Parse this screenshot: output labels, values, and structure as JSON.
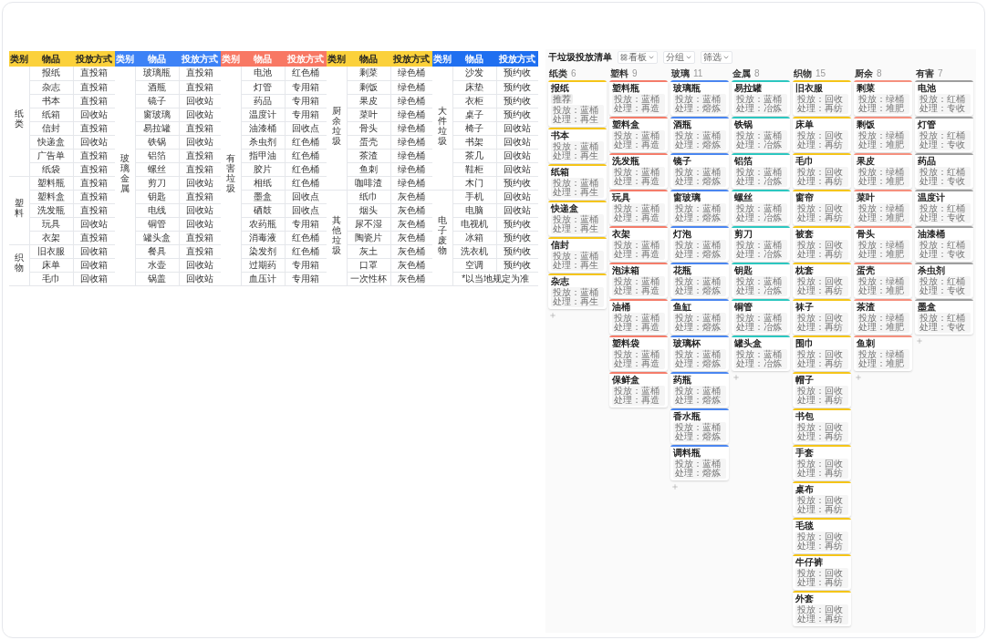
{
  "table": {
    "groups": [
      {
        "category_header": "类别",
        "item_header": "物品",
        "method_header": "投放方式",
        "color": "#fbd13b",
        "sections": [
          {
            "label": "纸类",
            "rows": [
              {
                "item": "报纸",
                "method": "直投箱"
              },
              {
                "item": "杂志",
                "method": "直投箱"
              },
              {
                "item": "书本",
                "method": "直投箱"
              },
              {
                "item": "纸箱",
                "method": "回收站"
              },
              {
                "item": "信封",
                "method": "直投箱"
              },
              {
                "item": "快递盒",
                "method": "回收站"
              },
              {
                "item": "广告单",
                "method": "直投箱"
              },
              {
                "item": "纸袋",
                "method": "直投箱"
              }
            ]
          },
          {
            "label": "塑料",
            "rows": [
              {
                "item": "塑料瓶",
                "method": "直投箱"
              },
              {
                "item": "塑料盒",
                "method": "直投箱"
              },
              {
                "item": "洗发瓶",
                "method": "直投箱"
              },
              {
                "item": "玩具",
                "method": "回收站"
              },
              {
                "item": "衣架",
                "method": "直投箱"
              }
            ]
          },
          {
            "label": "织物",
            "rows": [
              {
                "item": "旧衣服",
                "method": "回收箱"
              },
              {
                "item": "床单",
                "method": "回收箱"
              },
              {
                "item": "毛巾",
                "method": "回收箱"
              }
            ]
          }
        ]
      },
      {
        "category_header": "类别",
        "item_header": "物品",
        "method_header": "投放方式",
        "color": "#3d82f6",
        "sections": [
          {
            "label": "玻璃金属",
            "rows": [
              {
                "item": "玻璃瓶",
                "method": "直投箱"
              },
              {
                "item": "酒瓶",
                "method": "直投箱"
              },
              {
                "item": "镜子",
                "method": "回收站"
              },
              {
                "item": "窗玻璃",
                "method": "回收站"
              },
              {
                "item": "易拉罐",
                "method": "直投箱"
              },
              {
                "item": "铁锅",
                "method": "回收站"
              },
              {
                "item": "铝箔",
                "method": "直投箱"
              },
              {
                "item": "螺丝",
                "method": "直投箱"
              },
              {
                "item": "剪刀",
                "method": "回收站"
              },
              {
                "item": "钥匙",
                "method": "直投箱"
              },
              {
                "item": "电线",
                "method": "回收站"
              },
              {
                "item": "铜管",
                "method": "回收站"
              },
              {
                "item": "罐头盒",
                "method": "直投箱"
              },
              {
                "item": "餐具",
                "method": "直投箱"
              },
              {
                "item": "水壶",
                "method": "回收站"
              },
              {
                "item": "锅盖",
                "method": "回收站"
              }
            ]
          }
        ]
      },
      {
        "category_header": "类别",
        "item_header": "物品",
        "method_header": "投放方式",
        "color": "#f87864",
        "sections": [
          {
            "label": "有害垃圾",
            "rows": [
              {
                "item": "电池",
                "method": "红色桶"
              },
              {
                "item": "灯管",
                "method": "专用箱"
              },
              {
                "item": "药品",
                "method": "专用箱"
              },
              {
                "item": "温度计",
                "method": "专用箱"
              },
              {
                "item": "油漆桶",
                "method": "回收点"
              },
              {
                "item": "杀虫剂",
                "method": "红色桶"
              },
              {
                "item": "指甲油",
                "method": "红色桶"
              },
              {
                "item": "胶片",
                "method": "红色桶"
              },
              {
                "item": "相纸",
                "method": "红色桶"
              },
              {
                "item": "墨盒",
                "method": "回收点"
              },
              {
                "item": "硒鼓",
                "method": "回收点"
              },
              {
                "item": "农药瓶",
                "method": "专用箱"
              },
              {
                "item": "消毒液",
                "method": "红色桶"
              },
              {
                "item": "染发剂",
                "method": "红色桶"
              },
              {
                "item": "过期药",
                "method": "专用箱"
              },
              {
                "item": "血压计",
                "method": "专用箱"
              }
            ]
          }
        ]
      },
      {
        "category_header": "类别",
        "item_header": "物品",
        "method_header": "投放方式",
        "color": "#fbd13b",
        "sections": [
          {
            "label": "厨余垃圾",
            "rows": [
              {
                "item": "剩菜",
                "method": "绿色桶"
              },
              {
                "item": "剩饭",
                "method": "绿色桶"
              },
              {
                "item": "果皮",
                "method": "绿色桶"
              },
              {
                "item": "菜叶",
                "method": "绿色桶"
              },
              {
                "item": "骨头",
                "method": "绿色桶"
              },
              {
                "item": "蛋壳",
                "method": "绿色桶"
              },
              {
                "item": "茶渣",
                "method": "绿色桶"
              },
              {
                "item": "鱼刺",
                "method": "绿色桶"
              },
              {
                "item": "咖啡渣",
                "method": "绿色桶"
              }
            ]
          },
          {
            "label": "其他垃圾",
            "rows": [
              {
                "item": "纸巾",
                "method": "灰色桶"
              },
              {
                "item": "烟头",
                "method": "灰色桶"
              },
              {
                "item": "尿不湿",
                "method": "灰色桶"
              },
              {
                "item": "陶瓷片",
                "method": "灰色桶"
              },
              {
                "item": "灰土",
                "method": "灰色桶"
              },
              {
                "item": "口罩",
                "method": "灰色桶"
              },
              {
                "item": "一次性杯",
                "method": "灰色桶"
              }
            ]
          }
        ]
      },
      {
        "category_header": "类别",
        "item_header": "物品",
        "method_header": "投放方式",
        "color": "#1f6ff0",
        "note": "*以当地规定为准",
        "sections": [
          {
            "label": "大件垃圾",
            "rows": [
              {
                "item": "沙发",
                "method": "预约收"
              },
              {
                "item": "床垫",
                "method": "预约收"
              },
              {
                "item": "衣柜",
                "method": "预约收"
              },
              {
                "item": "桌子",
                "method": "预约收"
              },
              {
                "item": "椅子",
                "method": "回收站"
              },
              {
                "item": "书架",
                "method": "回收站"
              },
              {
                "item": "茶几",
                "method": "回收站"
              },
              {
                "item": "鞋柜",
                "method": "回收站"
              },
              {
                "item": "木门",
                "method": "预约收"
              }
            ]
          },
          {
            "label": "电子废物",
            "rows": [
              {
                "item": "手机",
                "method": "回收站"
              },
              {
                "item": "电脑",
                "method": "回收站"
              },
              {
                "item": "电视机",
                "method": "预约收"
              },
              {
                "item": "冰箱",
                "method": "预约收"
              },
              {
                "item": "洗衣机",
                "method": "预约收"
              },
              {
                "item": "空调",
                "method": "预约收"
              }
            ]
          }
        ]
      }
    ]
  },
  "board": {
    "title": "干垃圾投放清单",
    "controls": [
      "看板",
      "分组",
      "筛选"
    ],
    "columns": [
      {
        "name": "纸类",
        "count": "6",
        "color": "#f5c518",
        "add_button": true,
        "cards": [
          {
            "title": "报纸",
            "tag": "推荐",
            "lines": [
              "投放：蓝桶",
              "处理：再生"
            ]
          },
          {
            "title": "书本",
            "lines": [
              "投放：蓝桶",
              "处理：再生"
            ]
          },
          {
            "title": "纸箱",
            "lines": [
              "投放：蓝桶",
              "处理：再生"
            ]
          },
          {
            "title": "快递盒",
            "lines": [
              "投放：蓝桶",
              "处理：再生"
            ]
          },
          {
            "title": "信封",
            "lines": [
              "投放：蓝桶",
              "处理：再生"
            ]
          },
          {
            "title": "杂志",
            "lines": [
              "投放：蓝桶",
              "处理：再生"
            ]
          }
        ]
      },
      {
        "name": "塑料",
        "count": "9",
        "color": "#f47c6a",
        "add_button": false,
        "cards": [
          {
            "title": "塑料瓶",
            "lines": [
              "投放：蓝桶",
              "处理：再造"
            ]
          },
          {
            "title": "塑料盒",
            "lines": [
              "投放：蓝桶",
              "处理：再造"
            ]
          },
          {
            "title": "洗发瓶",
            "lines": [
              "投放：蓝桶",
              "处理：再造"
            ]
          },
          {
            "title": "玩具",
            "lines": [
              "投放：蓝桶",
              "处理：再造"
            ]
          },
          {
            "title": "衣架",
            "lines": [
              "投放：蓝桶",
              "处理：再造"
            ]
          },
          {
            "title": "泡沫箱",
            "lines": [
              "投放：蓝桶",
              "处理：再造"
            ]
          },
          {
            "title": "油桶",
            "lines": [
              "投放：蓝桶",
              "处理：再造"
            ]
          },
          {
            "title": "塑料袋",
            "lines": [
              "投放：蓝桶",
              "处理：再造"
            ]
          },
          {
            "title": "保鲜盒",
            "lines": [
              "投放：蓝桶",
              "处理：再造"
            ]
          }
        ]
      },
      {
        "name": "玻璃",
        "count": "11",
        "color": "#4a86f0",
        "add_button": true,
        "cards": [
          {
            "title": "玻璃瓶",
            "lines": [
              "投放：蓝桶",
              "处理：熔炼"
            ]
          },
          {
            "title": "酒瓶",
            "lines": [
              "投放：蓝桶",
              "处理：熔炼"
            ]
          },
          {
            "title": "镜子",
            "lines": [
              "投放：蓝桶",
              "处理：熔炼"
            ]
          },
          {
            "title": "窗玻璃",
            "lines": [
              "投放：蓝桶",
              "处理：熔炼"
            ]
          },
          {
            "title": "灯泡",
            "lines": [
              "投放：蓝桶",
              "处理：熔炼"
            ]
          },
          {
            "title": "花瓶",
            "lines": [
              "投放：蓝桶",
              "处理：熔炼"
            ]
          },
          {
            "title": "鱼缸",
            "lines": [
              "投放：蓝桶",
              "处理：熔炼"
            ]
          },
          {
            "title": "玻璃杯",
            "lines": [
              "投放：蓝桶",
              "处理：熔炼"
            ]
          },
          {
            "title": "药瓶",
            "lines": [
              "投放：蓝桶",
              "处理：熔炼"
            ]
          },
          {
            "title": "香水瓶",
            "lines": [
              "投放：蓝桶",
              "处理：熔炼"
            ]
          },
          {
            "title": "调料瓶",
            "lines": [
              "投放：蓝桶",
              "处理：熔炼"
            ]
          }
        ]
      },
      {
        "name": "金属",
        "count": "8",
        "color": "#2cc7c0",
        "add_button": true,
        "cards": [
          {
            "title": "易拉罐",
            "lines": [
              "投放：蓝桶",
              "处理：冶炼"
            ]
          },
          {
            "title": "铁锅",
            "lines": [
              "投放：蓝桶",
              "处理：冶炼"
            ]
          },
          {
            "title": "铝箔",
            "lines": [
              "投放：蓝桶",
              "处理：冶炼"
            ]
          },
          {
            "title": "螺丝",
            "lines": [
              "投放：蓝桶",
              "处理：冶炼"
            ]
          },
          {
            "title": "剪刀",
            "lines": [
              "投放：蓝桶",
              "处理：冶炼"
            ]
          },
          {
            "title": "钥匙",
            "lines": [
              "投放：蓝桶",
              "处理：冶炼"
            ]
          },
          {
            "title": "铜管",
            "lines": [
              "投放：蓝桶",
              "处理：冶炼"
            ]
          },
          {
            "title": "罐头盒",
            "lines": [
              "投放：蓝桶",
              "处理：冶炼"
            ]
          }
        ]
      },
      {
        "name": "织物",
        "count": "15",
        "color": "#f5c518",
        "add_button": false,
        "cards": [
          {
            "title": "旧衣服",
            "lines": [
              "投放：回收",
              "处理：再纺"
            ]
          },
          {
            "title": "床单",
            "lines": [
              "投放：回收",
              "处理：再纺"
            ]
          },
          {
            "title": "毛巾",
            "lines": [
              "投放：回收",
              "处理：再纺"
            ]
          },
          {
            "title": "窗帘",
            "lines": [
              "投放：回收",
              "处理：再纺"
            ]
          },
          {
            "title": "被套",
            "lines": [
              "投放：回收",
              "处理：再纺"
            ]
          },
          {
            "title": "枕套",
            "lines": [
              "投放：回收",
              "处理：再纺"
            ]
          },
          {
            "title": "袜子",
            "lines": [
              "投放：回收",
              "处理：再纺"
            ]
          },
          {
            "title": "围巾",
            "lines": [
              "投放：回收",
              "处理：再纺"
            ]
          },
          {
            "title": "帽子",
            "lines": [
              "投放：回收",
              "处理：再纺"
            ]
          },
          {
            "title": "书包",
            "lines": [
              "投放：回收",
              "处理：再纺"
            ]
          },
          {
            "title": "手套",
            "lines": [
              "投放：回收",
              "处理：再纺"
            ]
          },
          {
            "title": "桌布",
            "lines": [
              "投放：回收",
              "处理：再纺"
            ]
          },
          {
            "title": "毛毯",
            "lines": [
              "投放：回收",
              "处理：再纺"
            ]
          },
          {
            "title": "牛仔裤",
            "lines": [
              "投放：回收",
              "处理：再纺"
            ]
          },
          {
            "title": "外套",
            "lines": [
              "投放：回收",
              "处理：再纺"
            ]
          }
        ]
      },
      {
        "name": "厨余",
        "count": "8",
        "color": "#f5907e",
        "add_button": true,
        "cards": [
          {
            "title": "剩菜",
            "lines": [
              "投放：绿桶",
              "处理：堆肥"
            ]
          },
          {
            "title": "剩饭",
            "lines": [
              "投放：绿桶",
              "处理：堆肥"
            ]
          },
          {
            "title": "果皮",
            "lines": [
              "投放：绿桶",
              "处理：堆肥"
            ]
          },
          {
            "title": "菜叶",
            "lines": [
              "投放：绿桶",
              "处理：堆肥"
            ]
          },
          {
            "title": "骨头",
            "lines": [
              "投放：绿桶",
              "处理：堆肥"
            ]
          },
          {
            "title": "蛋壳",
            "lines": [
              "投放：绿桶",
              "处理：堆肥"
            ]
          },
          {
            "title": "茶渣",
            "lines": [
              "投放：绿桶",
              "处理：堆肥"
            ]
          },
          {
            "title": "鱼刺",
            "lines": [
              "投放：绿桶",
              "处理：堆肥"
            ]
          }
        ]
      },
      {
        "name": "有害",
        "count": "7",
        "color": "#9e9e9e",
        "add_button": true,
        "cards": [
          {
            "title": "电池",
            "lines": [
              "投放：红桶",
              "处理：专收"
            ]
          },
          {
            "title": "灯管",
            "lines": [
              "投放：红桶",
              "处理：专收"
            ]
          },
          {
            "title": "药品",
            "lines": [
              "投放：红桶",
              "处理：专收"
            ]
          },
          {
            "title": "温度计",
            "lines": [
              "投放：红桶",
              "处理：专收"
            ]
          },
          {
            "title": "油漆桶",
            "lines": [
              "投放：红桶",
              "处理：专收"
            ]
          },
          {
            "title": "杀虫剂",
            "lines": [
              "投放：红桶",
              "处理：专收"
            ]
          },
          {
            "title": "墨盒",
            "lines": [
              "投放：红桶",
              "处理：专收"
            ]
          }
        ]
      }
    ]
  }
}
